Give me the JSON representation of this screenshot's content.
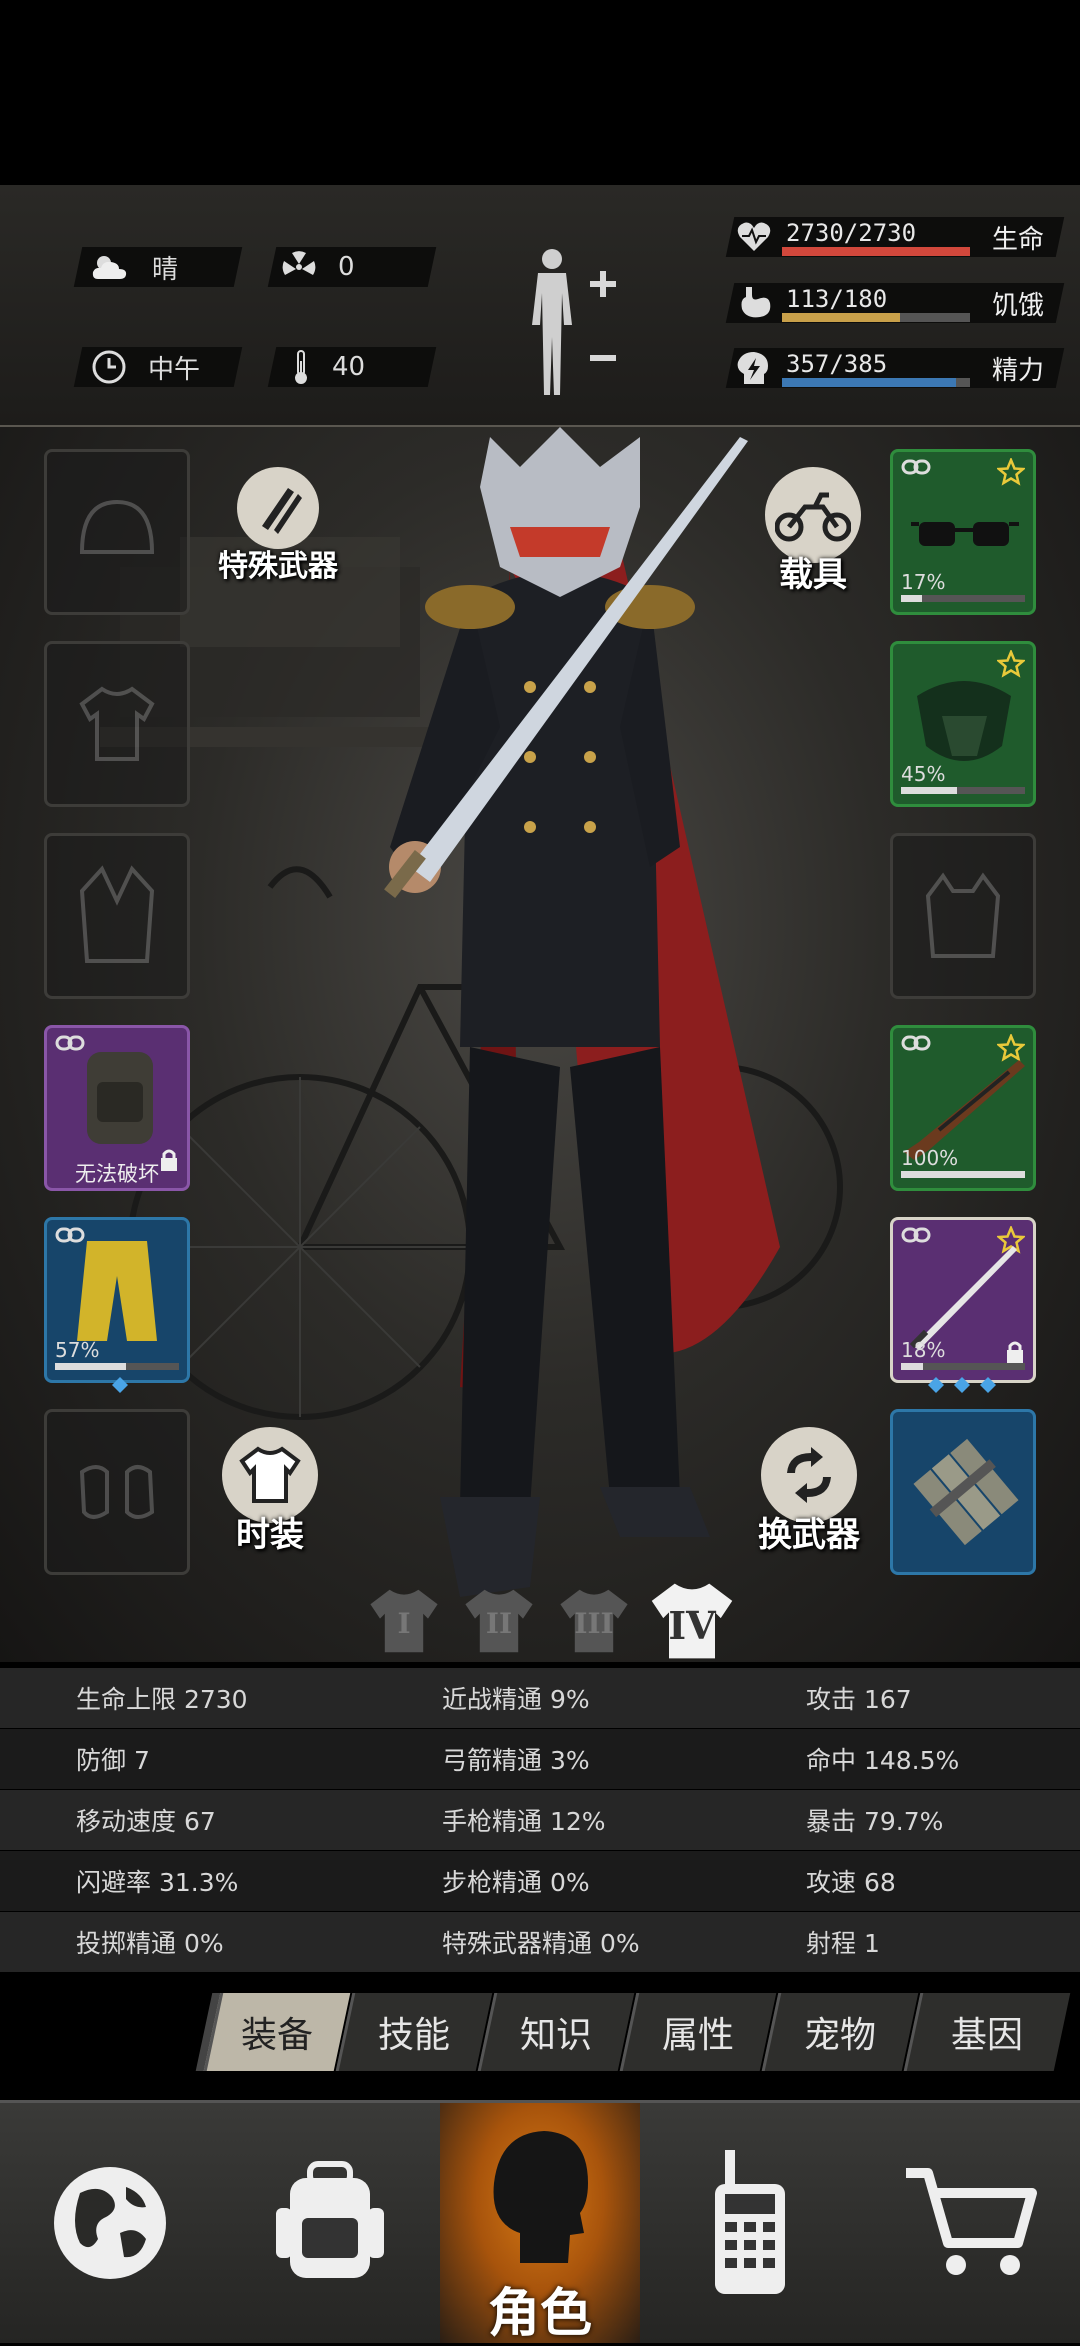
{
  "header": {
    "weather": "晴",
    "radiation": "0",
    "time_of_day": "中午",
    "temperature": "40",
    "stats": [
      {
        "name": "生命",
        "value": "2730/2730",
        "ratio": 1.0,
        "color": "#d2483c",
        "icon": "heart-pulse-icon"
      },
      {
        "name": "饥饿",
        "value": "113/180",
        "ratio": 0.628,
        "color": "#c8a04a",
        "icon": "stomach-icon"
      },
      {
        "name": "精力",
        "value": "357/385",
        "ratio": 0.927,
        "color": "#3c78b4",
        "icon": "energy-head-icon"
      }
    ]
  },
  "equipment": {
    "special_weapon_label": "特殊武器",
    "vehicle_label": "载具",
    "fashion_label": "时装",
    "switch_weapon_label": "换武器",
    "backpack_label": "无法破坏",
    "pants_pct": "57%",
    "pants_ratio": 0.57,
    "glasses_pct": "17%",
    "glasses_ratio": 0.17,
    "mask_pct": "45%",
    "mask_ratio": 0.45,
    "rifle_pct": "100%",
    "rifle_ratio": 1.0,
    "sword_pct": "18%",
    "sword_ratio": 0.18,
    "tiers": [
      "I",
      "II",
      "III",
      "IV"
    ],
    "active_tier": "IV"
  },
  "stats_table": [
    [
      "生命上限 2730",
      "近战精通 9%",
      "攻击 167"
    ],
    [
      "防御 7",
      "弓箭精通 3%",
      "命中 148.5%"
    ],
    [
      "移动速度 67",
      "手枪精通 12%",
      "暴击 79.7%"
    ],
    [
      "闪避率 31.3%",
      "步枪精通 0%",
      "攻速 68"
    ],
    [
      "投掷精通 0%",
      "特殊武器精通 0%",
      "射程 1"
    ]
  ],
  "tabs": [
    "装备",
    "技能",
    "知识",
    "属性",
    "宠物",
    "基因"
  ],
  "active_tab": "装备",
  "bottom_nav": {
    "role_label": "角色"
  }
}
